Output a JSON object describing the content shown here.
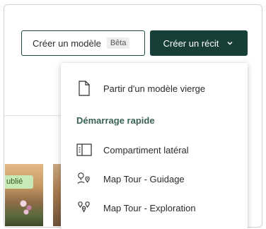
{
  "header": {
    "create_template": {
      "label": "Créer un modèle",
      "badge": "Bêta"
    },
    "create_story": {
      "label": "Créer un récit"
    }
  },
  "gallery": {
    "badge": "ublié"
  },
  "dropdown": {
    "blank_template": "Partir d'un modèle vierge",
    "quick_start_heading": "Démarrage rapide",
    "items": [
      {
        "label": "Compartiment latéral",
        "icon": "sidecar-icon"
      },
      {
        "label": "Map Tour - Guidage",
        "icon": "guided-map-tour-icon"
      },
      {
        "label": "Map Tour - Exploration",
        "icon": "explorer-map-tour-icon"
      }
    ]
  },
  "colors": {
    "primary_dark": "#173f38",
    "section_heading": "#3a6157",
    "badge_bg": "#c8e8b5"
  }
}
